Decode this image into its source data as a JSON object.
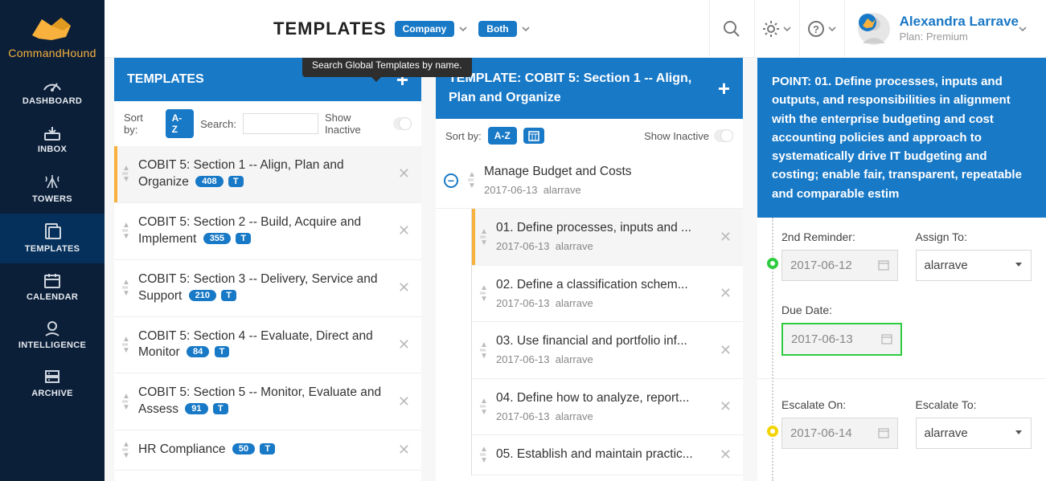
{
  "brand": {
    "name": "CommandHound"
  },
  "nav": {
    "items": [
      {
        "label": "DASHBOARD"
      },
      {
        "label": "INBOX"
      },
      {
        "label": "TOWERS"
      },
      {
        "label": "TEMPLATES"
      },
      {
        "label": "CALENDAR"
      },
      {
        "label": "INTELLIGENCE"
      },
      {
        "label": "ARCHIVE"
      }
    ]
  },
  "topbar": {
    "title": "TEMPLATES",
    "scope_pill": "Company",
    "view_pill": "Both",
    "user": {
      "name": "Alexandra Larrave",
      "plan": "Plan: Premium"
    }
  },
  "templatesPanel": {
    "title": "TEMPLATES",
    "tooltip": "Search Global Templates by name.",
    "sort_by_label": "Sort by:",
    "sort_badge": "A-Z",
    "search_label": "Search:",
    "show_inactive": "Show Inactive",
    "rows": [
      {
        "title": "COBIT 5: Section 1 -- Align, Plan and Organize",
        "count": "408",
        "tag": "T",
        "selected": true
      },
      {
        "title": "COBIT 5: Section 2 -- Build, Acquire and Implement",
        "count": "355",
        "tag": "T"
      },
      {
        "title": "COBIT 5: Section 3 -- Delivery, Service and Support",
        "count": "210",
        "tag": "T"
      },
      {
        "title": "COBIT 5: Section 4 -- Evaluate, Direct and Monitor",
        "count": "84",
        "tag": "T"
      },
      {
        "title": "COBIT 5: Section 5 -- Monitor, Evaluate and Assess",
        "count": "91",
        "tag": "T"
      },
      {
        "title": "HR Compliance",
        "count": "50",
        "tag": "T"
      }
    ]
  },
  "templateDetail": {
    "title": "TEMPLATE: COBIT 5: Section 1 -- Align, Plan and Organize",
    "sort_by_label": "Sort by:",
    "sort_badge": "A-Z",
    "show_inactive": "Show Inactive",
    "group": {
      "name": "Manage Budget and Costs",
      "date": "2017-06-13",
      "user": "alarrave"
    },
    "items": [
      {
        "title": "01. Define processes, inputs and ...",
        "date": "2017-06-13",
        "user": "alarrave",
        "selected": true
      },
      {
        "title": "02. Define a classification schem...",
        "date": "2017-06-13",
        "user": "alarrave"
      },
      {
        "title": "03. Use financial and portfolio inf...",
        "date": "2017-06-13",
        "user": "alarrave"
      },
      {
        "title": "04. Define how to analyze, report...",
        "date": "2017-06-13",
        "user": "alarrave"
      },
      {
        "title": "05. Establish and maintain practic...",
        "date": "",
        "user": ""
      }
    ]
  },
  "pointPanel": {
    "title": "POINT: 01. Define processes, inputs and outputs, and responsibilities in alignment with the enterprise budgeting and cost accounting policies and approach to systematically drive IT budgeting and costing; enable fair, transparent, repeatable and comparable estim",
    "reminder2_label": "2nd Reminder:",
    "reminder2_value": "2017-06-12",
    "assign_to_label": "Assign To:",
    "assign_to_value": "alarrave",
    "due_date_label": "Due Date:",
    "due_date_value": "2017-06-13",
    "escalate_on_label": "Escalate On:",
    "escalate_on_value": "2017-06-14",
    "escalate_to_label": "Escalate To:",
    "escalate_to_value": "alarrave"
  }
}
